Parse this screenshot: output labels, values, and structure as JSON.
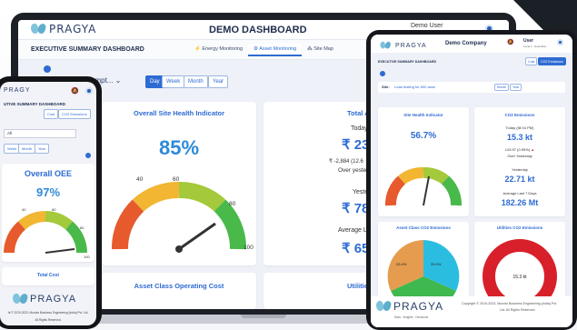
{
  "laptop": {
    "brand": "PRAGYA",
    "title": "DEMO DASHBOARD",
    "user": "Demo User",
    "subheader": "EXECUTIVE SUMMARY DASHBOARD",
    "tabs": [
      "Energy Monitoring",
      "Asset Monitoring",
      "Site Map"
    ],
    "active_tab": 1,
    "site_select": "umpt...",
    "period_buttons": [
      "Day",
      "Week",
      "Month",
      "Year"
    ],
    "site_health": {
      "title": "Overall Site Health Indicator",
      "value": "85%",
      "ticks": [
        "40",
        "60",
        "80",
        "100"
      ]
    },
    "total_asset": {
      "title": "Total Asset",
      "today_label": "Today (till 1",
      "today_value": "₹ 23,4",
      "delta": "₹ -2,884 (12.6",
      "over_yesterday": "Over yester",
      "yesterday_label": "Yesterd",
      "yesterday_value": "₹ 78,7",
      "average_label": "Average Las",
      "average_value": "₹ 65,8"
    },
    "asset_class": {
      "title": "Asset Class Operating Cost"
    },
    "utilities": {
      "title": "Utilities"
    }
  },
  "phone": {
    "brand": "PRAGY",
    "subheader": "UTIVE SUMMARY DASHBOARD",
    "buttons": [
      "Cost",
      "CO2 Emissions"
    ],
    "select_value": "All",
    "period_buttons": [
      "Week",
      "Month",
      "Year"
    ],
    "oee": {
      "title": "Overall OEE",
      "value": "97%",
      "ticks": [
        "40",
        "60",
        "80",
        "100"
      ]
    },
    "total_cost": "Total Cost",
    "footer_brand": "PRAGYA",
    "footer_copyright": "ht © 2019-2023, Munots Business Engineering (India) Pvt. Ltd.",
    "footer_rights": "All Rights Reserved."
  },
  "tablet": {
    "brand": "PRAGYA",
    "title": "Demo Company",
    "user": "User",
    "user_sub": "Level 1 - Executive",
    "subheader": "EXECUTIVE SUMMARY DASHBOARD",
    "buttons": [
      "Cost",
      "CO2 Emissions"
    ],
    "site_label": "Site:",
    "site_value": "Load testing for 600 asse",
    "period_buttons": [
      "Month",
      "Year"
    ],
    "site_health": {
      "title": "Site Health Indicator",
      "value": "56.7%"
    },
    "co2": {
      "title": "CO2 Emissions",
      "today_label": "Today (till 04 PM)",
      "today_value": "15.3 kt",
      "delta": "143.97 (0.95%)",
      "over_yesterday": "Over Yesterday",
      "yesterday_label": "Yesterday",
      "yesterday_value": "22.71 kt",
      "average_label": "Average Last 7 Days",
      "average_value": "182.26 Mt"
    },
    "asset_class": {
      "title": "Asset Class CO2 Emissions",
      "slices": [
        "33.6%",
        "33.0%",
        "33.4%"
      ]
    },
    "utilities": {
      "title": "Utilities CO2 Emissions",
      "center": "15.3 kt"
    },
    "footer_brand": "PRAGYA",
    "footer_tagline": "Data · Insights · Decisions",
    "footer_copyright": "Copyright © 2019-2023, Munots Business Engineering (India) Pvt.",
    "footer_rights": "Ltd. All Rights Reserved."
  }
}
